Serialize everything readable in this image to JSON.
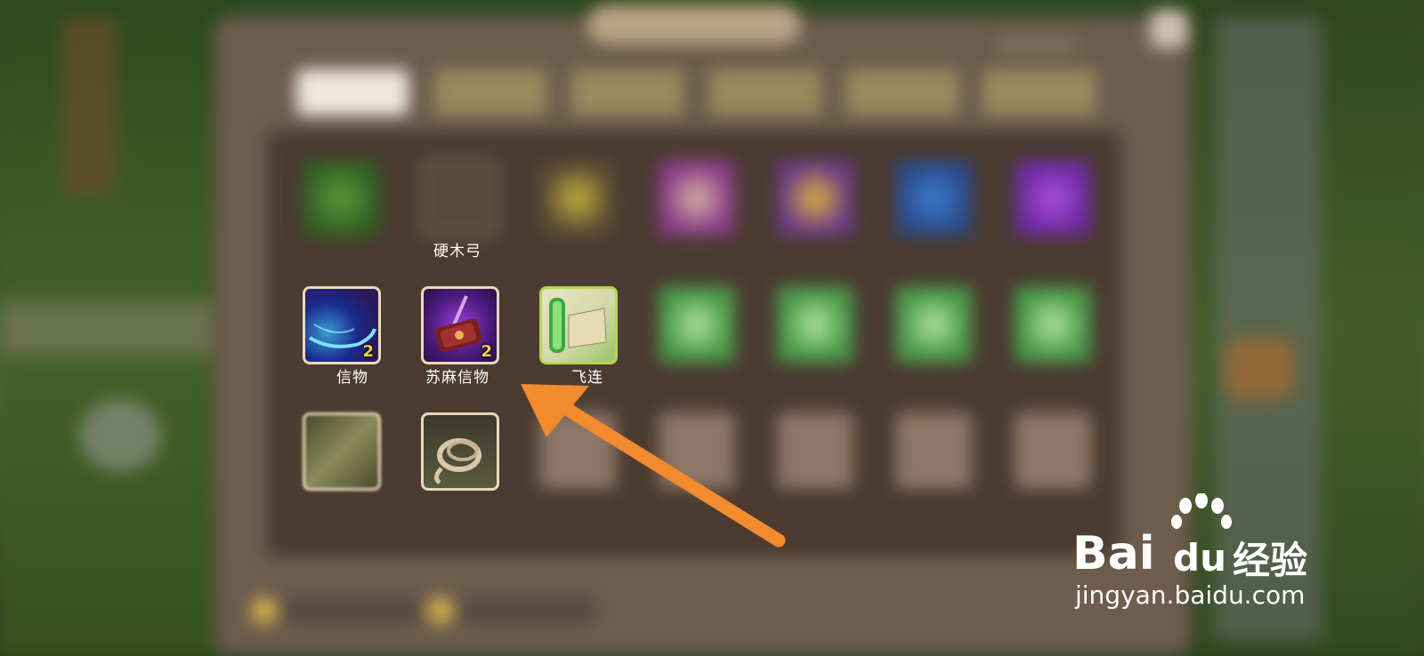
{
  "window": {
    "title": "",
    "tabs": [
      {
        "label": "",
        "active": true
      },
      {
        "label": "",
        "active": false
      },
      {
        "label": "",
        "active": false
      },
      {
        "label": "",
        "active": false
      },
      {
        "label": "",
        "active": false
      },
      {
        "label": "",
        "active": false
      }
    ]
  },
  "inventory": {
    "rows": [
      [
        {
          "name": "",
          "icon": "green-herb-icon",
          "qty": ""
        },
        {
          "name": "硬木弓",
          "icon": "bow-icon",
          "qty": ""
        },
        {
          "name": "",
          "icon": "gold-gem-icon",
          "qty": ""
        },
        {
          "name": "",
          "icon": "purple-scroll-icon",
          "qty": ""
        },
        {
          "name": "",
          "icon": "purple-orb-icon",
          "qty": ""
        },
        {
          "name": "",
          "icon": "blue-orb-icon",
          "qty": ""
        },
        {
          "name": "",
          "icon": "violet-orb-icon",
          "qty": ""
        }
      ],
      [
        {
          "name": "信物",
          "icon": "blue-wind-token-icon",
          "qty": "2"
        },
        {
          "name": "苏麻信物",
          "icon": "hammer-token-icon",
          "qty": "2"
        },
        {
          "name": "飞连",
          "icon": "green-scroll-icon",
          "qty": ""
        },
        {
          "name": "",
          "icon": "green-leaf-icon",
          "qty": ""
        },
        {
          "name": "",
          "icon": "green-leaf-icon",
          "qty": ""
        },
        {
          "name": "",
          "icon": "green-leaf-icon",
          "qty": ""
        },
        {
          "name": "",
          "icon": "green-leaf-icon",
          "qty": ""
        }
      ],
      [
        {
          "name": "",
          "icon": "bamboo-scroll-icon",
          "qty": ""
        },
        {
          "name": "",
          "icon": "rope-icon",
          "qty": ""
        },
        {
          "name": "",
          "icon": "empty",
          "qty": ""
        },
        {
          "name": "",
          "icon": "empty",
          "qty": ""
        },
        {
          "name": "",
          "icon": "empty",
          "qty": ""
        },
        {
          "name": "",
          "icon": "empty",
          "qty": ""
        },
        {
          "name": "",
          "icon": "empty",
          "qty": ""
        }
      ]
    ]
  },
  "annotation": {
    "arrow_color": "#f28a2e"
  },
  "watermark": {
    "brand": "Bai",
    "brand_suffix": "du",
    "cn": "经验",
    "url": "jingyan.baidu.com"
  },
  "colors": {
    "panel": "#6e5d4d",
    "grid": "#4b3b30",
    "quantity": "#f4d23a"
  }
}
